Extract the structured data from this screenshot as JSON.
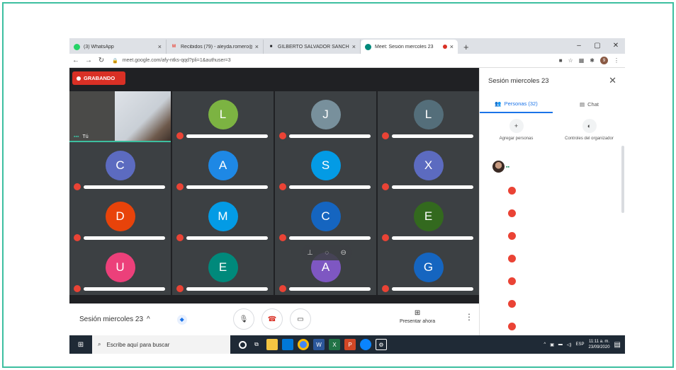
{
  "browser": {
    "tabs": [
      {
        "title": "(3) WhatsApp",
        "fav_color": "#25d366",
        "fav_glyph": ""
      },
      {
        "title": "Recibidos (79) - aleyda.romero@",
        "fav_color": "#ea4335",
        "fav_glyph": "M"
      },
      {
        "title": "GILBERTO SALVADOR SANCHEZ",
        "fav_color": "#202124",
        "fav_glyph": "■"
      },
      {
        "title": "Meet: Sesión miercoles 23",
        "fav_color": "#00897b",
        "fav_glyph": ""
      }
    ],
    "close_glyph": "×",
    "new_tab_glyph": "+",
    "window_controls": [
      "–",
      "▢",
      "✕"
    ],
    "url": "meet.google.com/afy-ntks-qqd?pli=1&authuser=3",
    "profile_initial": "9"
  },
  "meet": {
    "recording_label": "GRABANDO",
    "self_label": "Tú",
    "participants_grid": [
      {
        "letter": "L",
        "color": "#7cb342"
      },
      {
        "letter": "J",
        "color": "#78909c"
      },
      {
        "letter": "L",
        "color": "#546e7a"
      },
      {
        "letter": "C",
        "color": "#5c6bc0"
      },
      {
        "letter": "A",
        "color": "#1e88e5"
      },
      {
        "letter": "S",
        "color": "#039be5"
      },
      {
        "letter": "X",
        "color": "#5c6bc0"
      },
      {
        "letter": "D",
        "color": "#e8430a"
      },
      {
        "letter": "M",
        "color": "#039be5"
      },
      {
        "letter": "C",
        "color": "#1565c0"
      },
      {
        "letter": "E",
        "color": "#33691e"
      },
      {
        "letter": "U",
        "color": "#ec407a"
      },
      {
        "letter": "E",
        "color": "#00897b"
      },
      {
        "letter": "A",
        "color": "#7e57c2"
      },
      {
        "letter": "G",
        "color": "#1565c0"
      }
    ]
  },
  "controls": {
    "meeting_title": "Sesión miercoles 23",
    "present_label": "Presentar ahora"
  },
  "panel": {
    "title": "Sesión miercoles 23",
    "tab_people": "Personas (32)",
    "tab_chat": "Chat",
    "add_people": "Agregar personas",
    "host_controls": "Controles del organizador"
  },
  "taskbar": {
    "search_placeholder": "Escribe aquí para buscar",
    "language": "ESP",
    "time": "11:11 a. m.",
    "date": "23/09/2020"
  }
}
